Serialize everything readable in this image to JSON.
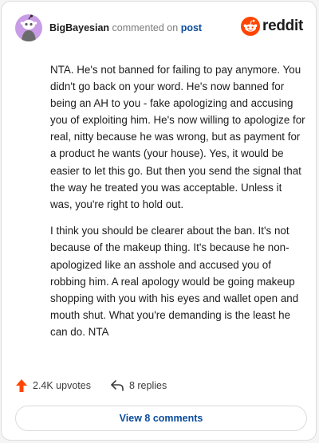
{
  "comment": {
    "author": "BigBayesian",
    "action_text": "commented on",
    "target_link": "post",
    "paragraphs": [
      "NTA. He's not banned for failing to pay anymore. You didn't go back on your word. He's now banned for being an AH to you - fake apologizing and accusing you of exploiting him. He's now willing to apologize for real, nitty because he was wrong, but as payment for a product he wants (your house). Yes, it would be easier to let this go. But then you send the signal that the way he treated you was acceptable. Unless it was, you're right to hold out.",
      "I think you should be clearer about the ban. It's not because of the makeup thing. It's because he non-apologized like an asshole and accused you of robbing him. A real apology would be going makeup shopping with you with his eyes and wallet open and mouth shut. What you're demanding is the least he can do. NTA"
    ]
  },
  "brand": {
    "logo_text": "reddit",
    "icon": "reddit-snoo-icon",
    "color": "#ff4500"
  },
  "actions": {
    "upvotes": "2.4K upvotes",
    "upvote_icon": "upvote-arrow-icon",
    "upvote_color": "#ff4500",
    "replies": "8 replies",
    "reply_icon": "reply-arrow-icon"
  },
  "footer": {
    "view_comments": "View 8 comments"
  },
  "colors": {
    "link": "#0a4c9c",
    "avatar_bg": "#c99ce6",
    "text": "#1c1c1c"
  }
}
